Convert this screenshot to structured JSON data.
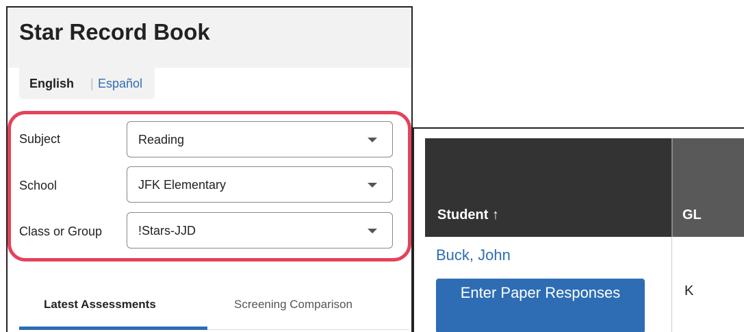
{
  "panel": {
    "title": "Star Record Book",
    "language": {
      "english": "English",
      "separator": "|",
      "spanish": "Español"
    },
    "filters": [
      {
        "label": "Subject",
        "value": "Reading"
      },
      {
        "label": "School",
        "value": "JFK Elementary"
      },
      {
        "label": "Class or Group",
        "value": "!Stars-JJD"
      }
    ],
    "tabs": [
      {
        "label": "Latest Assessments",
        "active": true
      },
      {
        "label": "Screening Comparison",
        "active": false
      }
    ],
    "highlight_color": "#e4435a",
    "accent_color": "#2e6db4"
  },
  "grid": {
    "columns": [
      {
        "label": "Student ↑"
      },
      {
        "label": "GL"
      }
    ],
    "rows": [
      {
        "student": "Buck, John",
        "button": "Enter Paper Responses",
        "gl": "K"
      }
    ]
  }
}
